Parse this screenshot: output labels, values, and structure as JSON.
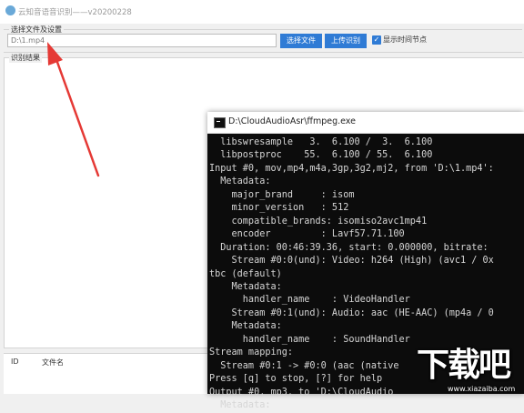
{
  "app": {
    "title": "云知音语音识别——v20200228",
    "select_group_label": "选择文件及设置",
    "file_input_value": "D:\\1.mp4",
    "select_file_button": "选择文件",
    "upload_button": "上传识别",
    "checkbox_checked": true,
    "checkbox_label": "显示时间节点",
    "result_group_label": "识别结果",
    "table_columns": [
      "ID",
      "文件名"
    ]
  },
  "console": {
    "title": "D:\\CloudAudioAsr\\ffmpeg.exe",
    "lines": [
      "  libswresample   3.  6.100 /  3.  6.100",
      "  libpostproc    55.  6.100 / 55.  6.100",
      "Input #0, mov,mp4,m4a,3gp,3g2,mj2, from 'D:\\1.mp4':",
      "  Metadata:",
      "    major_brand     : isom",
      "    minor_version   : 512",
      "    compatible_brands: isomiso2avc1mp41",
      "    encoder         : Lavf57.71.100",
      "  Duration: 00:46:39.36, start: 0.000000, bitrate:",
      "    Stream #0:0(und): Video: h264 (High) (avc1 / 0x",
      "tbc (default)",
      "    Metadata:",
      "      handler_name    : VideoHandler",
      "    Stream #0:1(und): Audio: aac (HE-AAC) (mp4a / 0",
      "    Metadata:",
      "      handler_name    : SoundHandler",
      "Stream mapping:",
      "  Stream #0:1 -> #0:0 (aac (native",
      "Press [q] to stop, [?] for help",
      "Output #0, mp3, to 'D:\\CloudAudio",
      "  Metadata:"
    ]
  },
  "watermark": {
    "text": "下载吧",
    "url": "www.xiazaiba.com"
  },
  "colors": {
    "accent": "#2f7bd5",
    "arrow": "#e53935",
    "console_bg": "#0c0c0c"
  }
}
